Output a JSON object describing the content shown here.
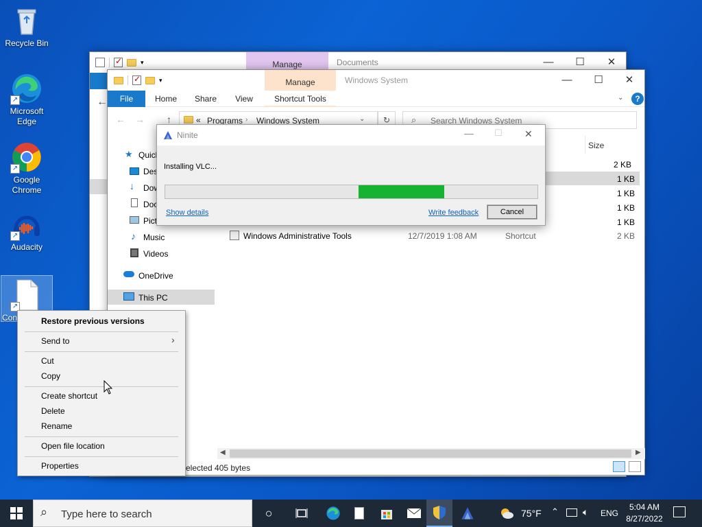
{
  "desktop": {
    "icons": [
      {
        "label": "Recycle Bin"
      },
      {
        "label": "Microsoft\nEdge"
      },
      {
        "label": "Google\nChrome"
      },
      {
        "label": "Audacity"
      },
      {
        "label": "Con"
      }
    ]
  },
  "explorer_back": {
    "manage_tab": "Manage",
    "title": "Documents"
  },
  "explorer_front": {
    "manage_tab": "Manage",
    "title": "Windows System",
    "ribbon_tabs": [
      "File",
      "Home",
      "Share",
      "View",
      "Shortcut Tools"
    ],
    "breadcrumb": {
      "sep": "«",
      "items": [
        "Programs",
        "Windows System"
      ]
    },
    "search_placeholder": "Search Windows System",
    "nav": [
      "Quick",
      "Des",
      "Dow",
      "Doc",
      "Pict",
      "Music",
      "Videos",
      "OneDrive",
      "This PC"
    ],
    "column_size": "Size",
    "sizes": [
      "2 KB",
      "1 KB",
      "1 KB",
      "1 KB",
      "1 KB",
      "2 KB"
    ],
    "visible_row": {
      "name": "Windows Administrative Tools",
      "date": "12/7/2019 1:08 AM",
      "type": "Shortcut",
      "size": "2 KB"
    },
    "status": "elected  405 bytes"
  },
  "ninite": {
    "title": "Ninite",
    "status": "Installing VLC...",
    "progress_fraction_start": 0.52,
    "progress_fraction_end": 0.75,
    "show_details": "Show details",
    "write_feedback": "Write feedback",
    "cancel": "Cancel"
  },
  "context_menu": {
    "items": {
      "restore": "Restore previous versions",
      "send_to": "Send to",
      "cut": "Cut",
      "copy": "Copy",
      "create_shortcut": "Create shortcut",
      "delete": "Delete",
      "rename": "Rename",
      "open_location": "Open file location",
      "properties": "Properties"
    }
  },
  "taskbar": {
    "search_placeholder": "Type here to search",
    "weather": "75°F",
    "lang": "ENG",
    "time": "5:04 AM",
    "date": "8/27/2022"
  },
  "colors": {
    "progress_green": "#16b232",
    "accent_blue": "#1979ca",
    "manage_back": "#e2c6f0",
    "manage_front": "#fde3cc"
  }
}
